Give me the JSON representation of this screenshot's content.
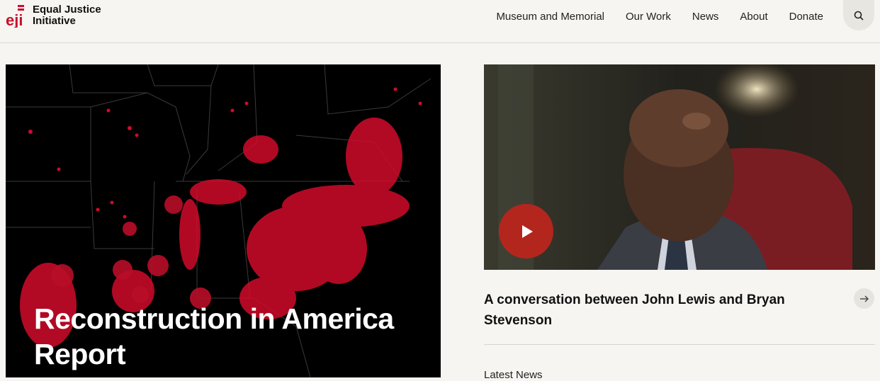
{
  "header": {
    "logo_text_line1": "Equal Justice",
    "logo_text_line2": "Initiative",
    "nav": [
      "Museum and Memorial",
      "Our Work",
      "News",
      "About",
      "Donate"
    ],
    "search_icon": "search-icon"
  },
  "hero": {
    "title_line1": "Reconstruction in America",
    "title_line2": "Report"
  },
  "feature": {
    "caption_line1": "A conversation between John Lewis and Bryan",
    "caption_line2": "Stevenson",
    "play_icon": "play-icon",
    "arrow_icon": "arrow-right-icon"
  },
  "latest": {
    "heading": "Latest News"
  },
  "colors": {
    "brand_red": "#c8102e",
    "play_red": "#b3261e",
    "background": "#f6f5f1"
  }
}
